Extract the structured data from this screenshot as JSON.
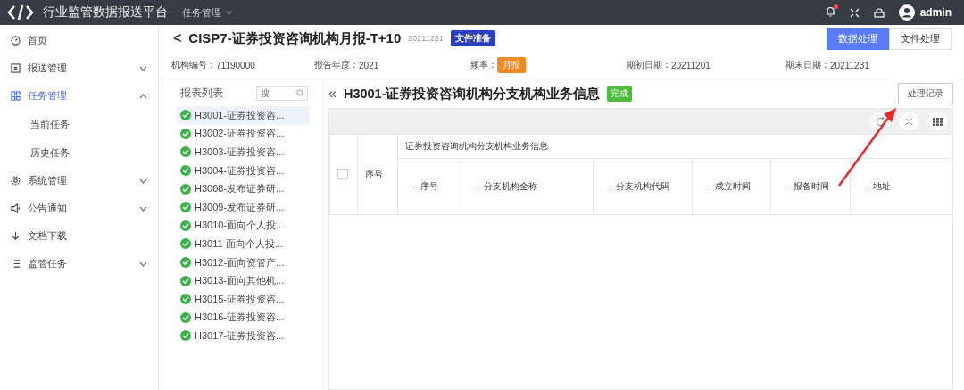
{
  "topbar": {
    "title": "行业监管数据报送平台",
    "menu": "任务管理",
    "user": "admin",
    "notification": true
  },
  "sidebar": {
    "items": [
      {
        "label": "首页",
        "selected": false
      },
      {
        "label": "报送管理",
        "expanded": false,
        "selected": false
      },
      {
        "label": "任务管理",
        "expanded": true,
        "selected": true,
        "children": [
          {
            "label": "当前任务",
            "selected": false
          },
          {
            "label": "历史任务",
            "selected": false
          }
        ]
      },
      {
        "label": "系统管理",
        "expanded": false,
        "selected": false
      },
      {
        "label": "公告通知",
        "expanded": false,
        "selected": false
      },
      {
        "label": "文档下载",
        "selected": false
      },
      {
        "label": "监管任务",
        "expanded": false,
        "selected": false
      }
    ]
  },
  "header": {
    "back": "<",
    "title": "CISP7-证券投资咨询机构月报-T+10",
    "date": "20211231",
    "status": "文件准备",
    "tabs": [
      {
        "label": "数据处理",
        "selected": true
      },
      {
        "label": "文件处理",
        "selected": false
      }
    ]
  },
  "info": [
    {
      "label": "机构编号：",
      "value": "71190000",
      "kind": "text"
    },
    {
      "label": "报告年度：",
      "value": "2021",
      "kind": "text"
    },
    {
      "label": "频率：",
      "value": "月报",
      "kind": "tag"
    },
    {
      "label": "期初日期：",
      "value": "20211201",
      "kind": "text"
    },
    {
      "label": "期末日期：",
      "value": "20211231",
      "kind": "text"
    }
  ],
  "report_list": {
    "title": "报表列表",
    "search": {
      "placeholder": "搜"
    },
    "items": [
      {
        "label": "H3001-证券投资咨...",
        "done": true,
        "selected": true
      },
      {
        "label": "H3002-证券投资咨...",
        "done": true,
        "selected": false
      },
      {
        "label": "H3003-证券投资咨...",
        "done": true,
        "selected": false
      },
      {
        "label": "H3004-证券投资咨...",
        "done": true,
        "selected": false
      },
      {
        "label": "H3008-发布证券研...",
        "done": true,
        "selected": false
      },
      {
        "label": "H3009-发布证券研...",
        "done": true,
        "selected": false
      },
      {
        "label": "H3010-面向个人投...",
        "done": true,
        "selected": false
      },
      {
        "label": "H3011-面向个人投...",
        "done": true,
        "selected": false
      },
      {
        "label": "H3012-面向资管产...",
        "done": true,
        "selected": false
      },
      {
        "label": "H3013-面向其他机...",
        "done": true,
        "selected": false
      },
      {
        "label": "H3015-证券投资咨...",
        "done": true,
        "selected": false
      },
      {
        "label": "H3016-证券投资咨...",
        "done": true,
        "selected": false
      },
      {
        "label": "H3017-证券投资咨...",
        "done": true,
        "selected": false
      }
    ]
  },
  "detail": {
    "back": "«",
    "title": "H3001-证券投资咨询机构分支机构业务信息",
    "status": "完成",
    "record_button": "处理记录",
    "table": {
      "select_all_checked": false,
      "index_column": "序号",
      "group_header": "证券投资咨询机构分支机构业务信息",
      "columns": [
        {
          "label": "序号",
          "required": true
        },
        {
          "label": "分支机构全称",
          "required": true
        },
        {
          "label": "分支机构代码",
          "required": true
        },
        {
          "label": "成立时间",
          "required": true
        },
        {
          "label": "报备时间",
          "required": true
        },
        {
          "label": "地址",
          "required": true
        }
      ]
    }
  }
}
